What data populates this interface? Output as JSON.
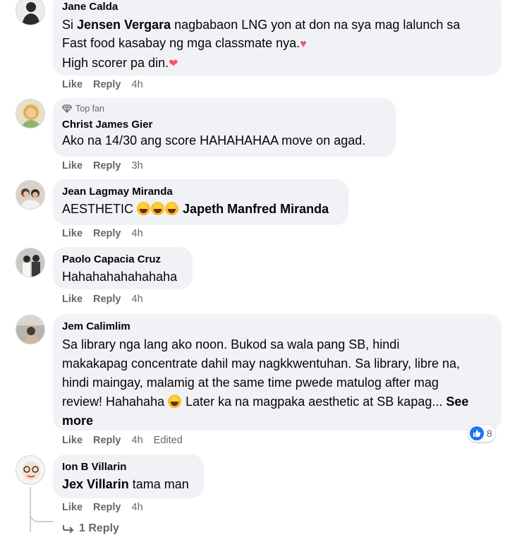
{
  "comments": [
    {
      "name": "Jane Calda",
      "lines": [
        {
          "prefix": "Si ",
          "mention": "Jensen Vergara",
          "rest": " nagbabaon LNG yon at don na sya mag lalunch sa"
        },
        {
          "text": "Fast food kasabay ng mga classmate nya."
        },
        {
          "text": "High scorer pa din."
        }
      ],
      "like": "Like",
      "reply": "Reply",
      "time": "4h"
    },
    {
      "badge": "Top fan",
      "name": "Christ James Gier",
      "text": "Ako na 14/30 ang score HAHAHAHAA move on agad.",
      "like": "Like",
      "reply": "Reply",
      "time": "3h"
    },
    {
      "name": "Jean Lagmay Miranda",
      "text": "AESTHETIC",
      "mention": "Japeth Manfred Miranda",
      "like": "Like",
      "reply": "Reply",
      "time": "4h"
    },
    {
      "name": "Paolo Capacia Cruz",
      "text": "Hahahahahahahaha",
      "like": "Like",
      "reply": "Reply",
      "time": "4h"
    },
    {
      "name": "Jem Calimlim",
      "lines": [
        "Sa library nga lang ako noon. Bukod sa wala pang SB, hindi",
        "makakapag concentrate dahil may nagkkwentuhan. Sa library, libre na,",
        "hindi maingay, malamig at the same time pwede matulog after mag",
        "review! Hahahaha",
        "Later ka na magpaka aesthetic at SB kapag..."
      ],
      "see_more": "See more",
      "reaction_count": "8",
      "like": "Like",
      "reply": "Reply",
      "time": "4h",
      "edited": "Edited"
    },
    {
      "name": "Ion B Villarin",
      "mention": "Jex Villarin",
      "text": "tama man",
      "like": "Like",
      "reply": "Reply",
      "time": "4h"
    }
  ],
  "replies_link": "1 Reply",
  "colors": {
    "bubble": "#f0f2f5",
    "meta": "#65676b",
    "like_blue": "#1877f2",
    "heart": "#f2566e"
  }
}
